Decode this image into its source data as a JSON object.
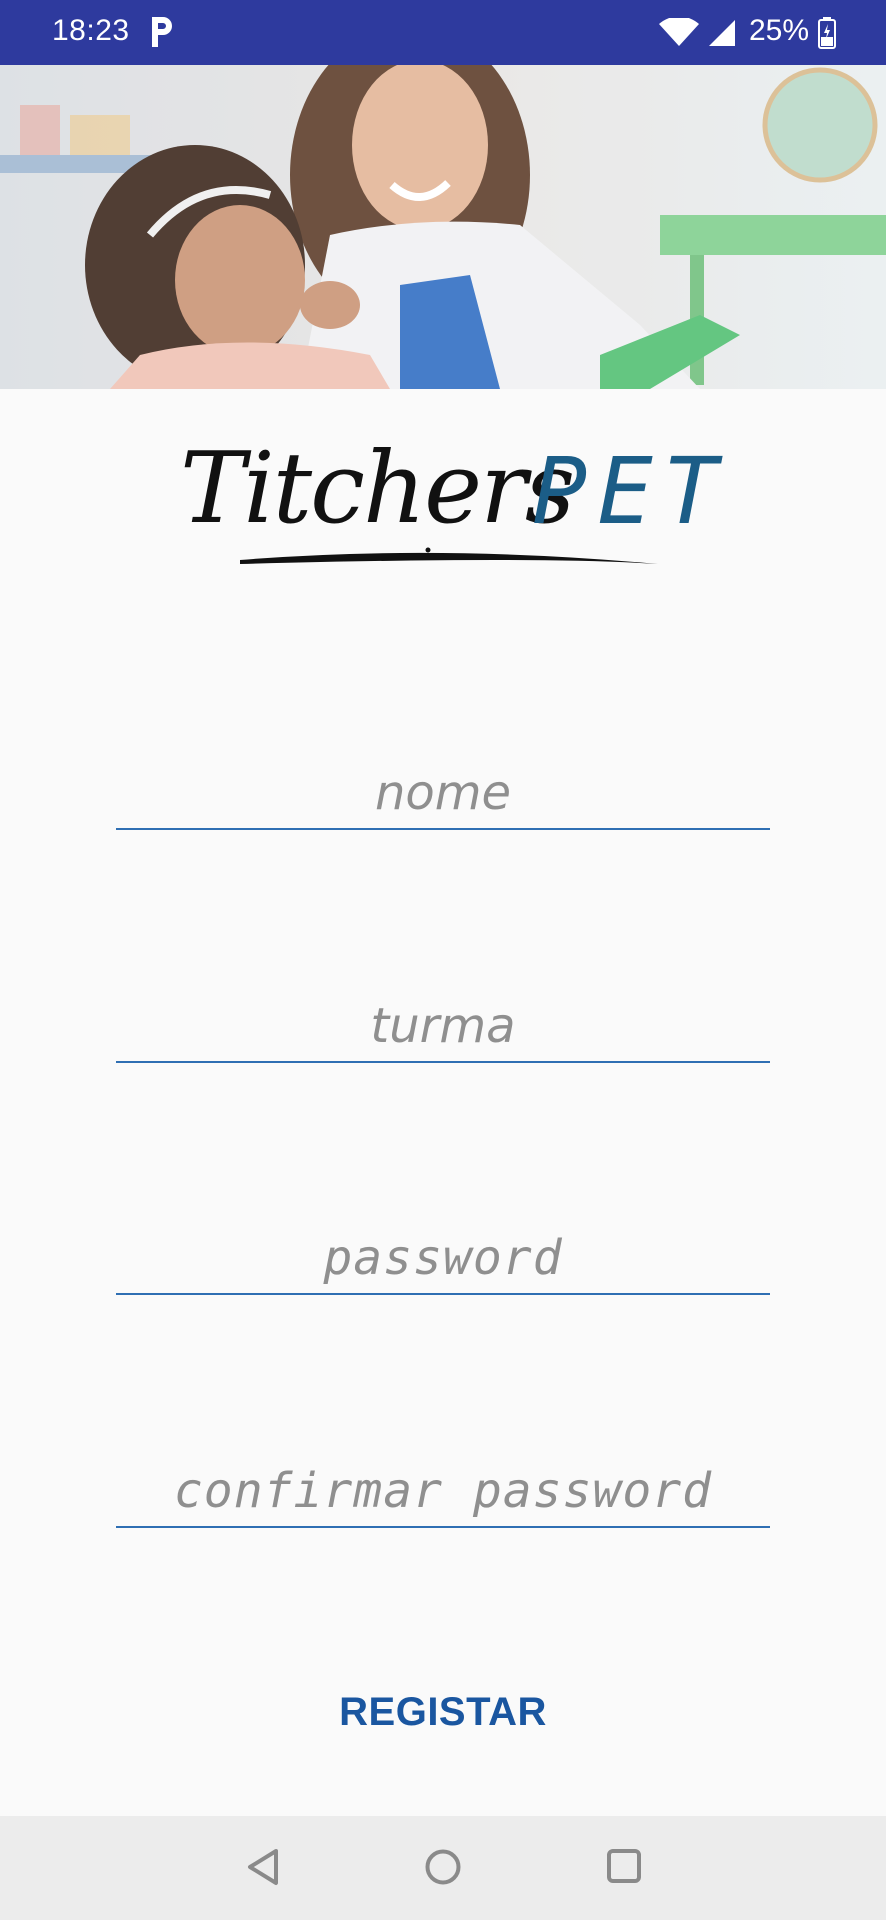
{
  "status_bar": {
    "time": "18:23",
    "battery": "25%",
    "icons": [
      "p-app-icon",
      "wifi-icon",
      "signal-icon",
      "battery-icon"
    ],
    "background": "#2e3a9e"
  },
  "hero": {
    "image": "teacher-helping-child-photo"
  },
  "logo": {
    "part1": "Titchers",
    "part2": "PET",
    "part2_color": "#1b5d87"
  },
  "form": {
    "name_placeholder": "nome",
    "class_placeholder": "turma",
    "password_placeholder": "password",
    "confirm_placeholder": "confirmar password",
    "underline_color": "#2f6fb3"
  },
  "actions": {
    "register_label": "REGISTAR",
    "accent": "#1a56a0"
  },
  "nav_bar": {
    "icons": [
      "back-icon",
      "home-icon",
      "recents-icon"
    ]
  }
}
